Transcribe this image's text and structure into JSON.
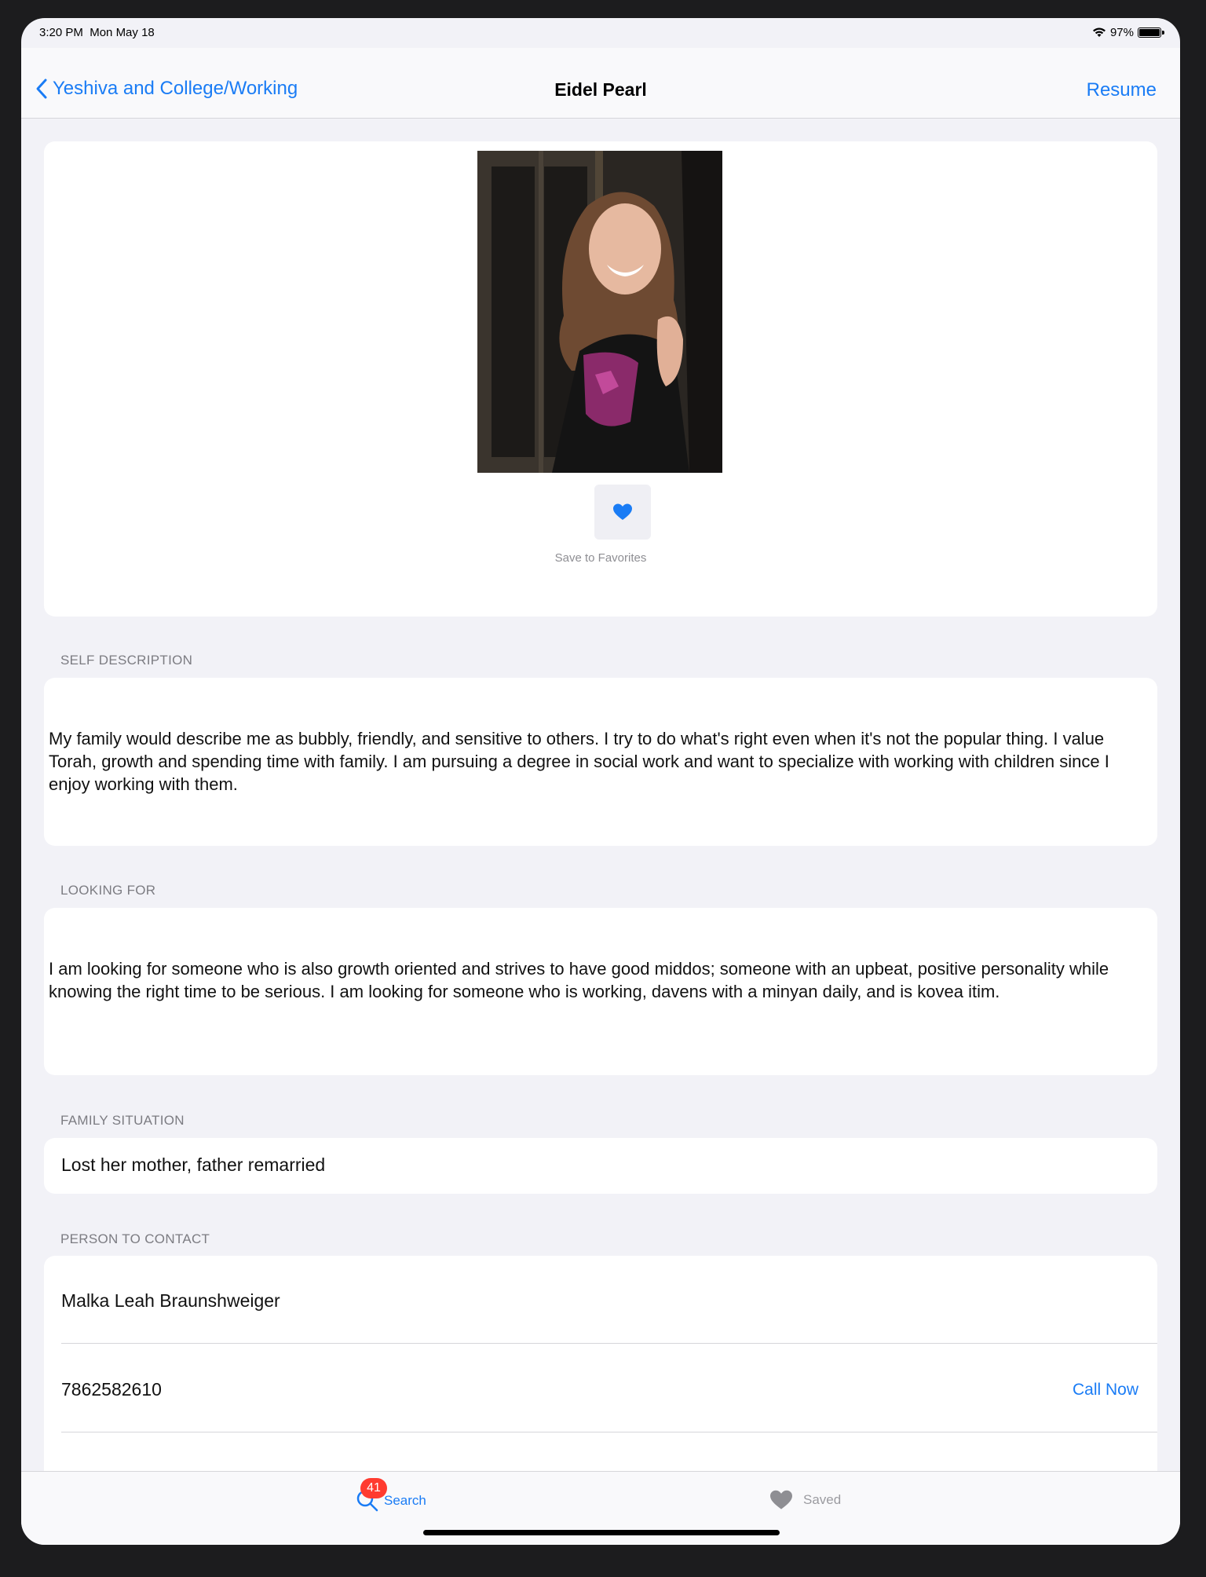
{
  "status_bar": {
    "time": "3:20 PM",
    "date": "Mon May 18",
    "battery": "97%"
  },
  "nav": {
    "back_label": "Yeshiva and College/Working",
    "title": "Eidel Pearl",
    "right_button": "Resume"
  },
  "profile": {
    "favorite_label": "Save to Favorites"
  },
  "sections": {
    "self_description": {
      "header": "SELF DESCRIPTION",
      "text": "My family would describe me as bubbly, friendly, and sensitive to others. I try to do what's right even when it's not the popular thing. I value Torah, growth and spending time with family. I am pursuing a degree in social work and want to specialize with working with children since I enjoy working with them."
    },
    "looking_for": {
      "header": "LOOKING FOR",
      "text": "I am looking for someone who is also growth oriented and strives to have good middos; someone with an upbeat, positive personality while knowing the right time to be serious. I am looking for someone who is working, davens with a minyan daily, and is kovea itim."
    },
    "family_situation": {
      "header": "FAMILY SITUATION",
      "text": "Lost her mother, father remarried"
    },
    "contact": {
      "header": "PERSON TO CONTACT",
      "name": "Malka Leah Braunshweiger",
      "phone": "7862582610",
      "call_label": "Call Now"
    }
  },
  "tabbar": {
    "search_label": "Search",
    "search_badge": "41",
    "saved_label": "Saved"
  },
  "colors": {
    "accent": "#1a7cf5",
    "badge": "#ff3b30",
    "background": "#f2f2f7"
  }
}
